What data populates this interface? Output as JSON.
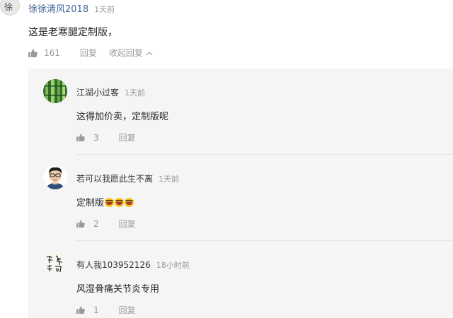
{
  "top_comment": {
    "avatar_glyph": "徐",
    "username": "徐徐清风2018",
    "time": "1天前",
    "text": "这是老寒腿定制版，",
    "likes": "161",
    "reply_label": "回复",
    "collapse_label": "收起回复"
  },
  "replies": [
    {
      "username": "江湖小过客",
      "time": "1天前",
      "text": "这得加价卖，定制版呢",
      "likes": "3",
      "reply_label": "回复",
      "avatar": "bamboo"
    },
    {
      "username": "若可以我愿此生不离",
      "time": "1天前",
      "text": "定制版",
      "emoji_count": 3,
      "likes": "2",
      "reply_label": "回复",
      "avatar": "cartoon-man"
    },
    {
      "username": "有人我103952126",
      "time": "18小时前",
      "text": "风湿骨痛关节炎专用",
      "likes": "1",
      "reply_label": "回复",
      "avatar": "calligraphy"
    }
  ],
  "colors": {
    "username": "#406599",
    "muted": "#999999",
    "reply_bg": "#f5f5f5"
  }
}
